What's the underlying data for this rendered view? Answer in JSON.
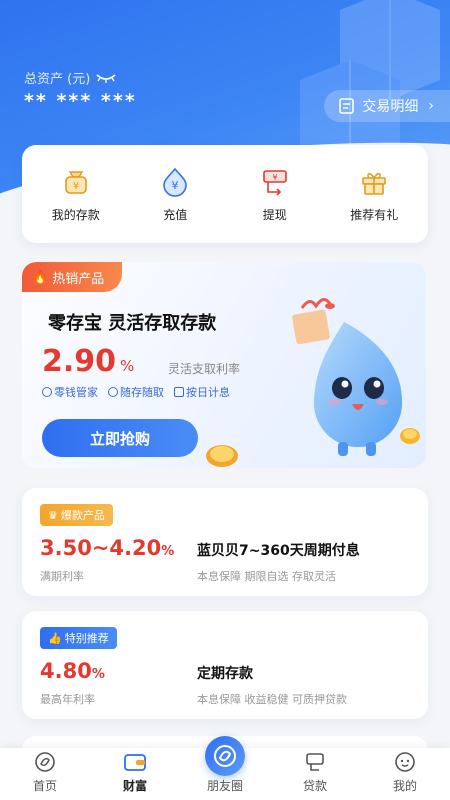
{
  "header": {
    "assets_label": "总资产 (元)",
    "assets_value": "** *** ***",
    "detail_label": "交易明细"
  },
  "quick_actions": [
    {
      "label": "我的存款",
      "icon": "money-bag-icon"
    },
    {
      "label": "充值",
      "icon": "yuan-drop-icon"
    },
    {
      "label": "提现",
      "icon": "withdraw-icon"
    },
    {
      "label": "推荐有礼",
      "icon": "gift-icon"
    }
  ],
  "hot_product": {
    "tag": "热销产品",
    "title": "零存宝 灵活存取存款",
    "rate": "2.90",
    "rate_unit": "%",
    "rate_label": "灵活支取利率",
    "features": [
      "零钱管家",
      "随存随取",
      "按日计息"
    ],
    "button": "立即抢购"
  },
  "products": [
    {
      "tag": "爆款产品",
      "rate": "3.50~4.20",
      "unit": "%",
      "rate_label": "满期利率",
      "name": "蓝贝贝7~360天周期付息",
      "desc": "本息保障 期限自选 存取灵活"
    },
    {
      "tag": "特别推荐",
      "rate": "4.80",
      "unit": "%",
      "rate_label": "最高年利率",
      "name": "定期存款",
      "desc": "本息保障 收益稳健 可质押贷款"
    }
  ],
  "tabs": [
    {
      "label": "首页",
      "icon": "home-icon"
    },
    {
      "label": "财富",
      "icon": "wallet-icon",
      "active": true
    },
    {
      "label": "朋友圈",
      "icon": "friends-icon"
    },
    {
      "label": "贷款",
      "icon": "loan-icon"
    },
    {
      "label": "我的",
      "icon": "profile-icon"
    }
  ],
  "colors": {
    "primary": "#2f6ff0",
    "accent": "#e3392e",
    "orange": "#f3a52c"
  }
}
